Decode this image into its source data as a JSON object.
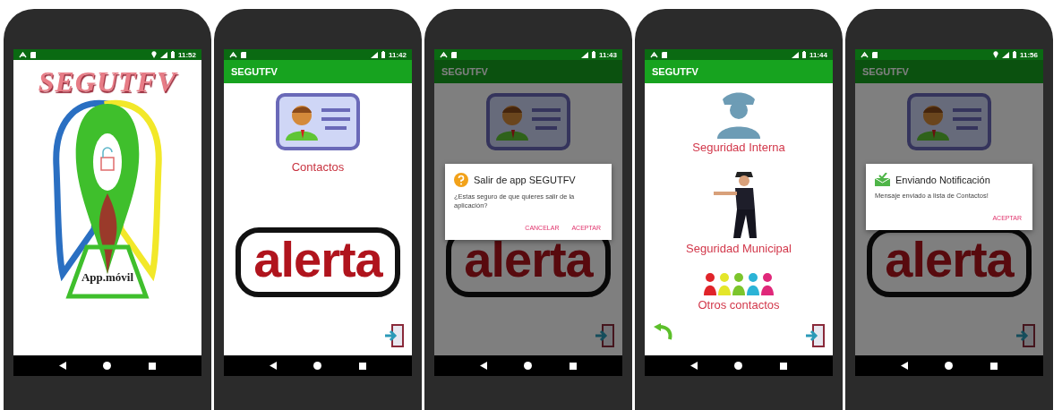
{
  "phones": [
    {
      "kind": "splash",
      "status": {
        "time": "11:52",
        "location": true
      },
      "logo": {
        "title": "SEGUTFV",
        "caption": "App.móvil"
      }
    },
    {
      "kind": "contacts",
      "status": {
        "time": "11:42",
        "location": false
      },
      "app_bar": "SEGUTFV",
      "dimmed": false,
      "menu": {
        "label": "Contactos",
        "brand": "alerta"
      }
    },
    {
      "kind": "contacts",
      "status": {
        "time": "11:43",
        "location": false
      },
      "app_bar": "SEGUTFV",
      "dimmed": true,
      "menu": {
        "brand": "alerta"
      },
      "dialog": {
        "kind": "confirm",
        "title": "Salir de app SEGUTFV",
        "message": "¿Estas seguro de que quieres salir de la aplicación?",
        "buttons": [
          "CANCELAR",
          "ACEPTAR"
        ]
      }
    },
    {
      "kind": "security",
      "status": {
        "time": "11:44",
        "location": false
      },
      "app_bar": "SEGUTFV",
      "dimmed": false,
      "options": [
        {
          "kind": "guard",
          "label": "Seguridad Interna"
        },
        {
          "kind": "police",
          "label": "Seguridad Municipal"
        },
        {
          "kind": "people",
          "label": "Otros contactos"
        }
      ]
    },
    {
      "kind": "contacts",
      "status": {
        "time": "11:56",
        "location": true
      },
      "app_bar": "SEGUTFV",
      "dimmed": true,
      "menu": {
        "brand": "alerta"
      },
      "dialog": {
        "kind": "info",
        "title": "Enviando Notificación",
        "message": "Mensaje enviado a lista de Contactos!",
        "buttons": [
          "ACEPTAR"
        ]
      }
    }
  ]
}
